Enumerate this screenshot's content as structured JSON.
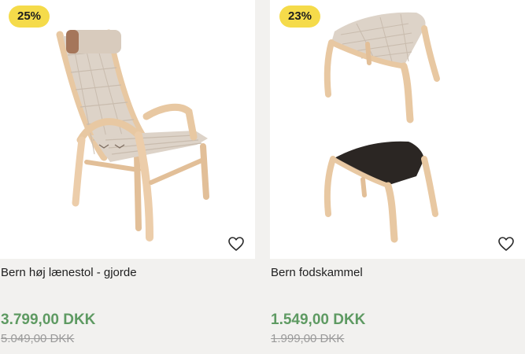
{
  "products": [
    {
      "badge": "25%",
      "name": "Bern høj lænestol - gjorde",
      "price": "3.799,00 DKK",
      "old_price": "5.049,00 DKK",
      "image": "armchair-high-back-webbing",
      "fav_icon": "heart-outline-icon"
    },
    {
      "badge": "23%",
      "name": "Bern fodskammel",
      "price": "1.549,00 DKK",
      "old_price": "1.999,00 DKK",
      "image": "footstool-webbing-and-leather",
      "fav_icon": "heart-outline-icon"
    }
  ],
  "colors": {
    "badge": "#f5db4a",
    "price": "#5e9a62",
    "old_price": "#9a9a9a",
    "wood": "#e9c9a4",
    "webbing": "#ddd2c6",
    "leather": "#2b2623"
  }
}
